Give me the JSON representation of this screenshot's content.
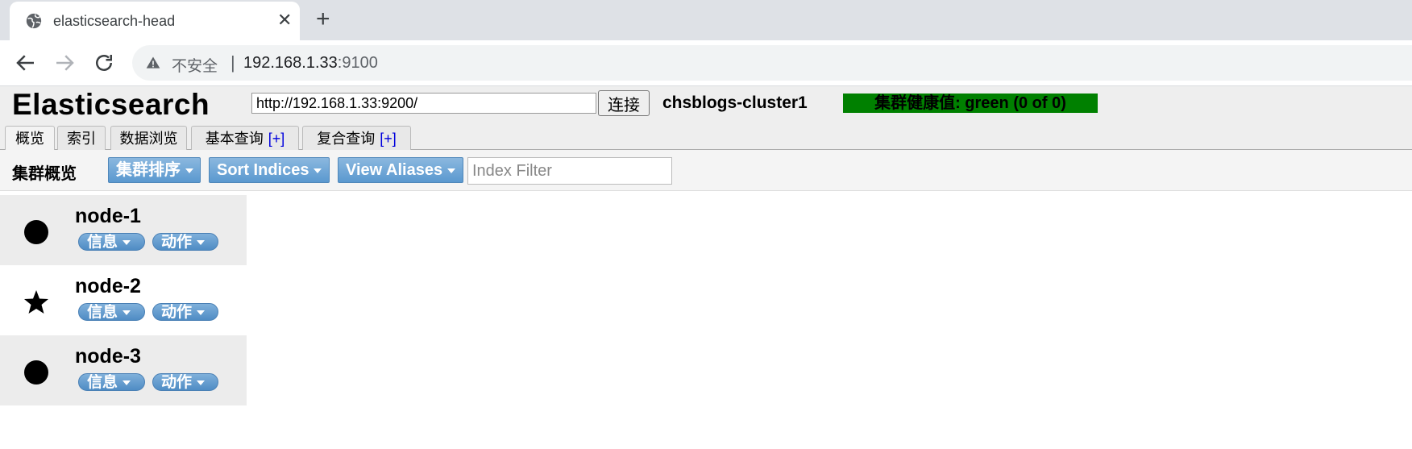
{
  "browser": {
    "tab_title": "elasticsearch-head",
    "address_insecure": "不安全",
    "address_separator": "|",
    "address_host": "192.168.1.33",
    "address_port": ":9100"
  },
  "app": {
    "logo": "Elasticsearch",
    "connect_uri": "http://192.168.1.33:9200/",
    "connect_button": "连接",
    "cluster_name": "chsblogs-cluster1",
    "health": "集群健康值: green (0 of 0)",
    "health_color": "#008000",
    "tabs": [
      {
        "label": "概览"
      },
      {
        "label": "索引"
      },
      {
        "label": "数据浏览"
      },
      {
        "label": "基本查询",
        "plus": "[+]"
      },
      {
        "label": "复合查询",
        "plus": "[+]"
      }
    ]
  },
  "overview": {
    "title": "集群概览",
    "sort_cluster": "集群排序",
    "sort_indices": "Sort Indices",
    "view_aliases": "View Aliases",
    "index_filter_placeholder": "Index Filter"
  },
  "nodes": [
    {
      "name": "node-1",
      "icon": "circle-icon",
      "info": "信息",
      "action": "动作"
    },
    {
      "name": "node-2",
      "icon": "star-icon",
      "info": "信息",
      "action": "动作"
    },
    {
      "name": "node-3",
      "icon": "circle-icon",
      "info": "信息",
      "action": "动作"
    }
  ]
}
